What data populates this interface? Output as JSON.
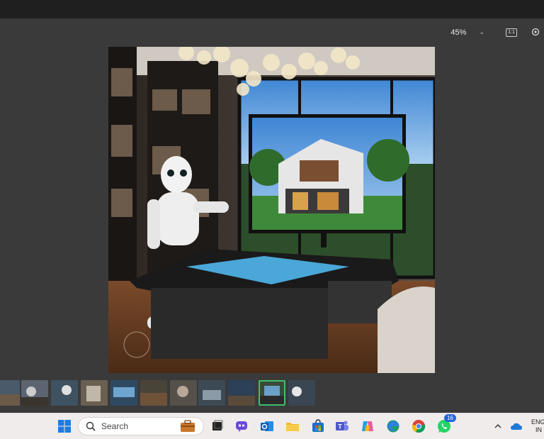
{
  "viewer": {
    "zoom_level": "45%",
    "actual_size_label": "1:1",
    "thumbnail_count": 11,
    "selected_thumbnail": 9
  },
  "taskbar": {
    "search_placeholder": "Search",
    "whatsapp_badge": "16",
    "language_line1": "ENG",
    "language_line2": "IN"
  },
  "colors": {
    "viewer_bg": "#3a3a3a",
    "taskbar_bg": "#f1ecec",
    "selection_accent": "#3fbf6b"
  },
  "icons": [
    "windows-start-icon",
    "search-icon",
    "briefcase-icon",
    "task-view-icon",
    "copilot-icon",
    "outlook-icon",
    "file-explorer-icon",
    "store-icon",
    "teams-icon",
    "copilot-app-icon",
    "edge-icon",
    "chrome-icon",
    "whatsapp-icon",
    "chevron-up-icon",
    "onedrive-icon"
  ]
}
